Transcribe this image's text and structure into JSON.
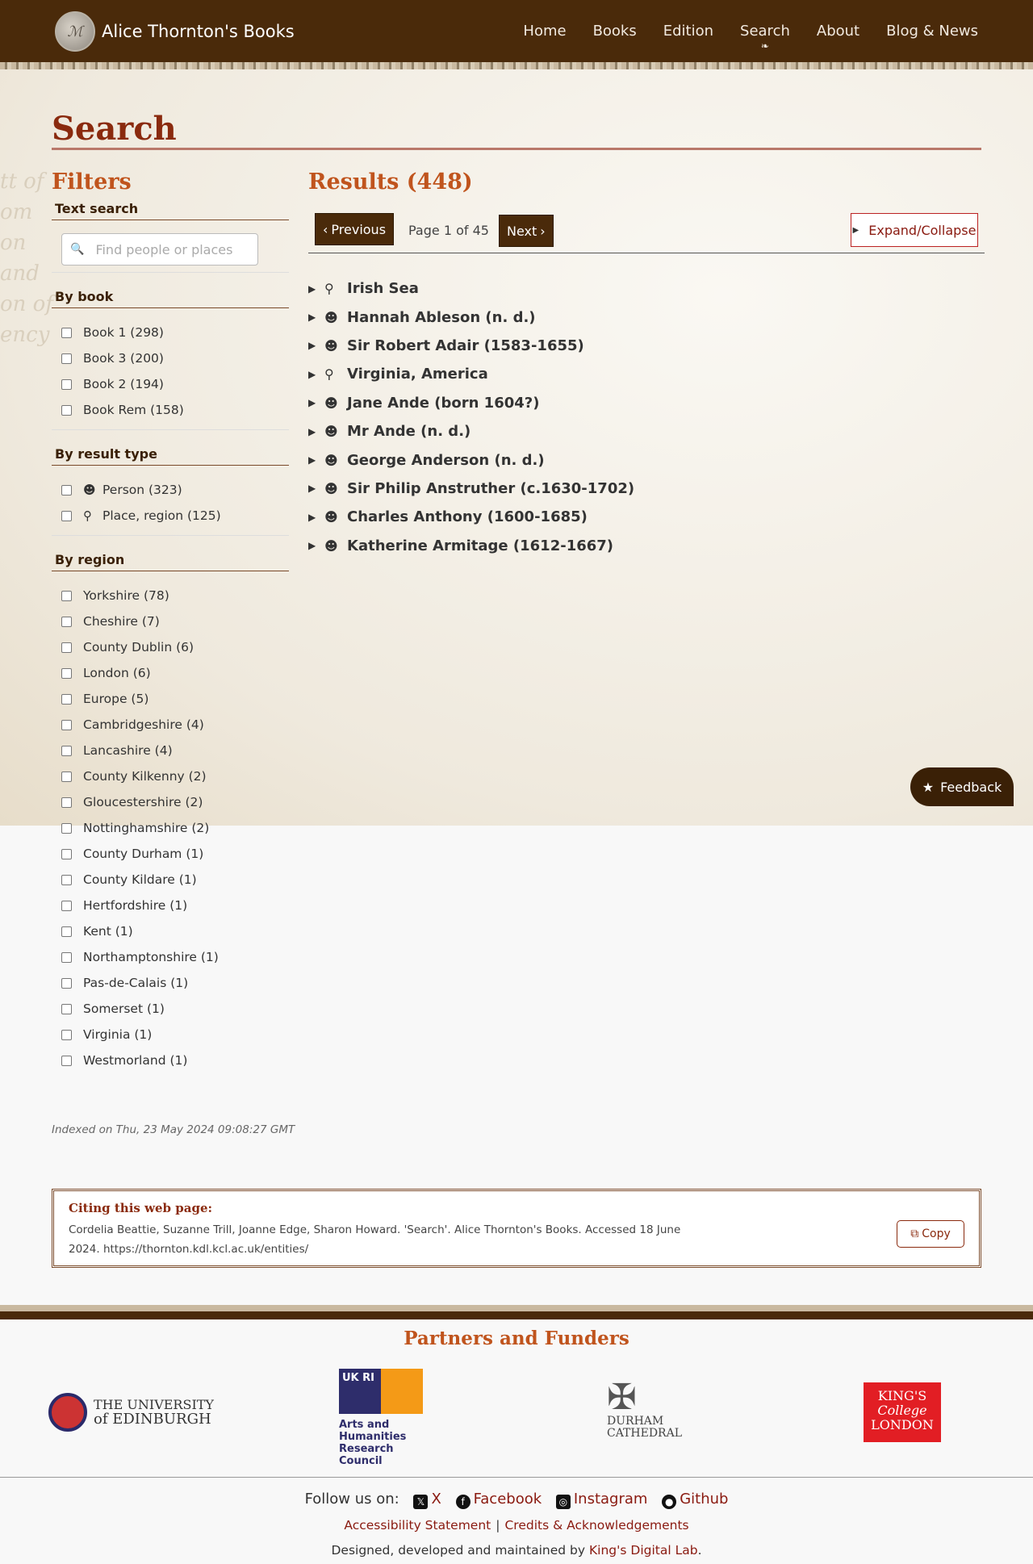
{
  "header": {
    "logo_text": "ℳ",
    "brand": "Alice Thornton's Books",
    "nav": [
      "Home",
      "Books",
      "Edition",
      "Search",
      "About",
      "Blog & News"
    ],
    "active_nav": "Search"
  },
  "page": {
    "title": "Search"
  },
  "filters": {
    "title": "Filters",
    "text_search": {
      "heading": "Text search",
      "placeholder": "Find people or places"
    },
    "by_book": {
      "heading": "By book",
      "options": [
        "Book 1 (298)",
        "Book 3 (200)",
        "Book 2 (194)",
        "Book Rem (158)"
      ]
    },
    "by_result_type": {
      "heading": "By result type",
      "options": [
        {
          "label": "Person (323)",
          "icon": "person-icon"
        },
        {
          "label": "Place, region (125)",
          "icon": "map-marker-icon"
        }
      ]
    },
    "by_region": {
      "heading": "By region",
      "options": [
        "Yorkshire (78)",
        "Cheshire (7)",
        "County Dublin (6)",
        "London (6)",
        "Europe (5)",
        "Cambridgeshire (4)",
        "Lancashire (4)",
        "County Kilkenny (2)",
        "Gloucestershire (2)",
        "Nottinghamshire (2)",
        "County Durham (1)",
        "County Kildare (1)",
        "Hertfordshire (1)",
        "Kent (1)",
        "Northamptonshire (1)",
        "Pas-de-Calais (1)",
        "Somerset (1)",
        "Virginia (1)",
        "Westmorland (1)"
      ]
    }
  },
  "results": {
    "title": "Results (448)",
    "prev_label": "Previous",
    "page_text": "Page 1 of 45",
    "next_label": "Next",
    "expand_label": "Expand/Collapse",
    "items": [
      {
        "label": "Irish Sea",
        "type": "place"
      },
      {
        "label": "Hannah Ableson (n. d.)",
        "type": "person"
      },
      {
        "label": "Sir Robert Adair (1583-1655)",
        "type": "person"
      },
      {
        "label": "Virginia, America",
        "type": "place"
      },
      {
        "label": "Jane Ande (born 1604?)",
        "type": "person"
      },
      {
        "label": "Mr Ande (n. d.)",
        "type": "person"
      },
      {
        "label": "George Anderson (n. d.)",
        "type": "person"
      },
      {
        "label": "Sir Philip Anstruther (c.1630-1702)",
        "type": "person"
      },
      {
        "label": "Charles Anthony (1600-1685)",
        "type": "person"
      },
      {
        "label": "Katherine Armitage (1612-1667)",
        "type": "person"
      }
    ]
  },
  "feedback_label": "Feedback",
  "indexed": "Indexed on Thu, 23 May 2024 09:08:27 GMT",
  "citation": {
    "heading": "Citing this web page:",
    "text": "Cordelia Beattie, Suzanne Trill, Joanne Edge, Sharon Howard. 'Search'. Alice Thornton's Books. Accessed 18 June 2024. https://thornton.kdl.kcl.ac.uk/entities/",
    "copy_label": "Copy"
  },
  "partners": {
    "title": "Partners and Funders",
    "edinburgh": [
      "THE UNIVERSITY",
      "of EDINBURGH"
    ],
    "ukri_mark": "UK RI",
    "ukri": [
      "Arts and",
      "Humanities",
      "Research Council"
    ],
    "durham": [
      "DURHAM",
      "CATHEDRAL"
    ],
    "kcl": [
      "KING'S",
      "College",
      "LONDON"
    ]
  },
  "footer": {
    "follow": "Follow us on:",
    "social": [
      {
        "label": "X",
        "icon": "x-icon"
      },
      {
        "label": "Facebook",
        "icon": "facebook-icon"
      },
      {
        "label": "Instagram",
        "icon": "instagram-icon"
      },
      {
        "label": "Github",
        "icon": "github-icon"
      }
    ],
    "accessibility": "Accessibility Statement",
    "credits": "Credits & Acknowledgements",
    "designed": "Designed, developed and maintained by",
    "kdl": "King's Digital Lab",
    "period": "."
  },
  "colors": {
    "header_bg": "#4a2a0a",
    "accent": "#c0541d",
    "title": "#8a2a0e",
    "link": "#8a1a10"
  }
}
